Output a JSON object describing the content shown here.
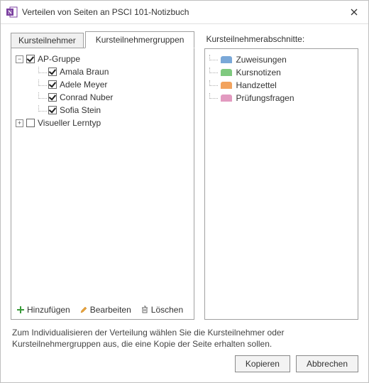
{
  "window": {
    "title": "Verteilen von Seiten an PSCI 101-Notizbuch"
  },
  "tabs": {
    "students": "Kursteilnehmer",
    "groups": "Kursteilnehmergruppen"
  },
  "tree": [
    {
      "label": "AP-Gruppe",
      "checked": true,
      "expandable": true,
      "expanded": true,
      "level": 0
    },
    {
      "label": "Amala Braun",
      "checked": true,
      "level": 1
    },
    {
      "label": "Adele Meyer",
      "checked": true,
      "level": 1
    },
    {
      "label": "Conrad Nuber",
      "checked": true,
      "level": 1
    },
    {
      "label": "Sofia Stein",
      "checked": true,
      "level": 1
    },
    {
      "label": "Visueller Lerntyp",
      "checked": false,
      "expandable": true,
      "expanded": false,
      "level": 0
    }
  ],
  "toolbar": {
    "add": "Hinzufügen",
    "edit": "Bearbeiten",
    "delete": "Löschen"
  },
  "sections_header": "Kursteilnehmerabschnitte:",
  "sections": [
    {
      "label": "Zuweisungen",
      "color": "#7aa8d8"
    },
    {
      "label": "Kursnotizen",
      "color": "#7fc97f"
    },
    {
      "label": "Handzettel",
      "color": "#f2a35e"
    },
    {
      "label": "Prüfungsfragen",
      "color": "#e29ac0"
    }
  ],
  "hint": "Zum Individualisieren der Verteilung wählen Sie die Kursteilnehmer oder Kursteilnehmergruppen aus, die eine Kopie der Seite erhalten sollen.",
  "buttons": {
    "copy": "Kopieren",
    "cancel": "Abbrechen"
  }
}
